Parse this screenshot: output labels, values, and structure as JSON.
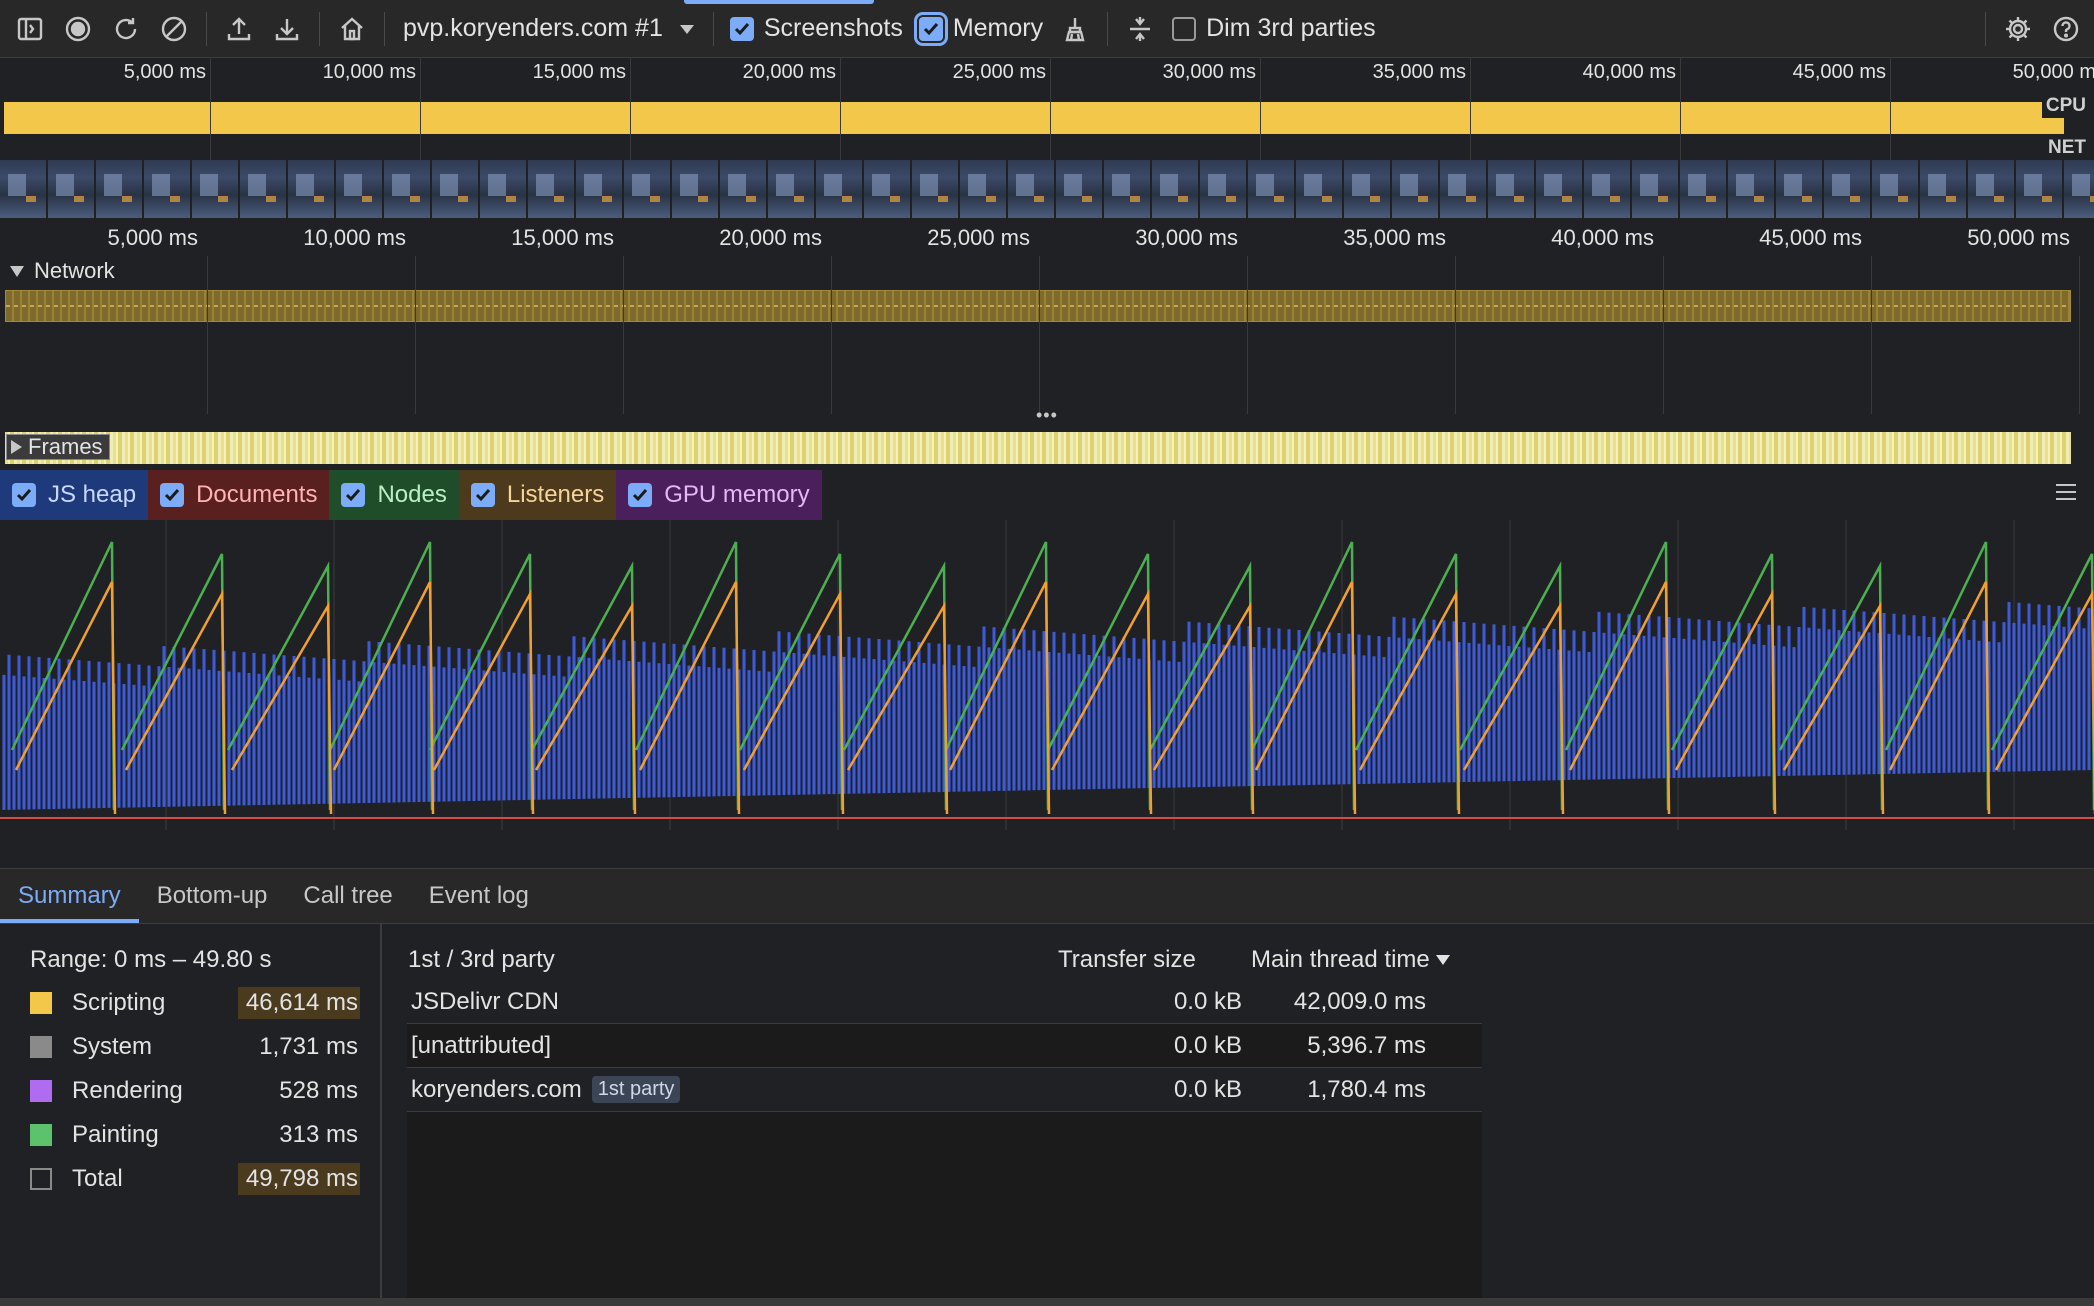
{
  "toolbar": {
    "recording_title": "pvp.koryenders.com #1",
    "screenshots_label": "Screenshots",
    "screenshots_checked": true,
    "memory_label": "Memory",
    "memory_checked": true,
    "dim_label": "Dim 3rd parties",
    "dim_checked": false
  },
  "overview": {
    "ticks": [
      "5,000 ms",
      "10,000 ms",
      "15,000 ms",
      "20,000 ms",
      "25,000 ms",
      "30,000 ms",
      "35,000 ms",
      "40,000 ms",
      "45,000 ms",
      "50,000 m"
    ],
    "cpu_label": "CPU",
    "net_label": "NET"
  },
  "timeline": {
    "ticks": [
      "5,000 ms",
      "10,000 ms",
      "15,000 ms",
      "20,000 ms",
      "25,000 ms",
      "30,000 ms",
      "35,000 ms",
      "40,000 ms",
      "45,000 ms",
      "50,000 ms"
    ]
  },
  "tracks": {
    "network_label": "Network",
    "frames_label": "Frames"
  },
  "memory": {
    "counters": [
      {
        "label": "JS heap",
        "color": "#3b5bdb",
        "checked": true
      },
      {
        "label": "Documents",
        "color": "#d94848",
        "checked": true
      },
      {
        "label": "Nodes",
        "color": "#4caf50",
        "checked": true
      },
      {
        "label": "Listeners",
        "color": "#f0a030",
        "checked": true
      },
      {
        "label": "GPU memory",
        "color": "#a040d0",
        "checked": true
      }
    ]
  },
  "bottom": {
    "tabs": [
      "Summary",
      "Bottom-up",
      "Call tree",
      "Event log"
    ],
    "active_tab": "Summary"
  },
  "summary": {
    "range": "Range: 0 ms – 49.80 s",
    "categories": [
      {
        "name": "Scripting",
        "value": "46,614 ms",
        "color": "#f3c84a",
        "highlight": true
      },
      {
        "name": "System",
        "value": "1,731 ms",
        "color": "#8a8a8a",
        "highlight": false
      },
      {
        "name": "Rendering",
        "value": "528 ms",
        "color": "#b06cf0",
        "highlight": false
      },
      {
        "name": "Painting",
        "value": "313 ms",
        "color": "#5cc26b",
        "highlight": false
      },
      {
        "name": "Total",
        "value": "49,798 ms",
        "color": "none",
        "highlight": true
      }
    ]
  },
  "third_party": {
    "headers": {
      "party": "1st / 3rd party",
      "transfer": "Transfer size",
      "main_thread": "Main thread time"
    },
    "rows": [
      {
        "name": "JSDelivr CDN",
        "badge": "",
        "transfer": "0.0 kB",
        "time": "42,009.0 ms"
      },
      {
        "name": "[unattributed]",
        "badge": "",
        "transfer": "0.0 kB",
        "time": "5,396.7 ms"
      },
      {
        "name": "koryenders.com",
        "badge": "1st party",
        "transfer": "0.0 kB",
        "time": "1,780.4 ms"
      }
    ]
  }
}
